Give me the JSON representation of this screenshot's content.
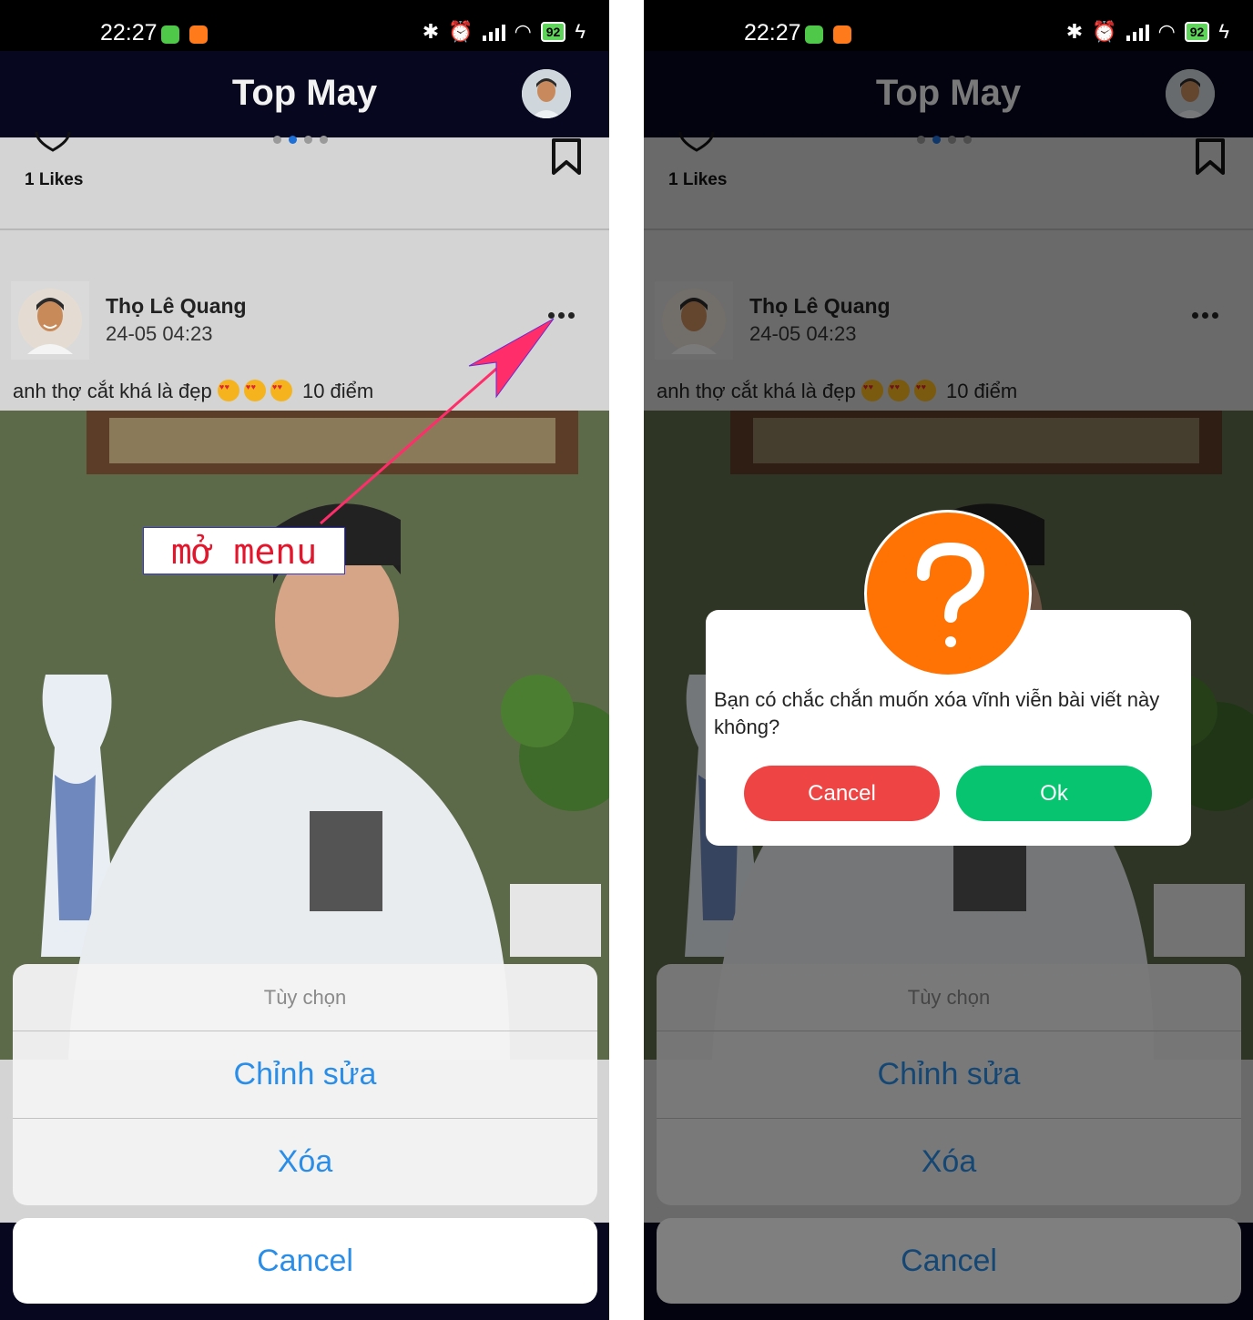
{
  "status_bar": {
    "time": "22:27",
    "battery": "92"
  },
  "header": {
    "title": "Top May"
  },
  "post": {
    "likes": "1 Likes",
    "author": "Thọ Lê Quang",
    "time": "24-05 04:23",
    "caption_text": "anh thợ cắt khá là đẹp",
    "caption_score": "10 điểm"
  },
  "action_sheet": {
    "title": "Tùy chọn",
    "edit": "Chỉnh sửa",
    "delete": "Xóa",
    "cancel": "Cancel"
  },
  "annotation": {
    "label": "mở menu"
  },
  "dialog": {
    "message": "Bạn có chắc chắn muốn xóa vĩnh viễn bài viết này không?",
    "cancel": "Cancel",
    "ok": "Ok"
  },
  "colors": {
    "header_bg": "#07071f",
    "accent_blue": "#2a8ee8",
    "dialog_cancel": "#ef4444",
    "dialog_ok": "#07c470",
    "question_orange": "#ff7305",
    "annotation_red": "#e2172d"
  },
  "icons": [
    "heart-icon",
    "bookmark-icon",
    "more-icon",
    "bluetooth-icon",
    "alarm-icon",
    "signal-icon",
    "wifi-icon",
    "battery-icon",
    "charging-icon",
    "question-icon"
  ]
}
